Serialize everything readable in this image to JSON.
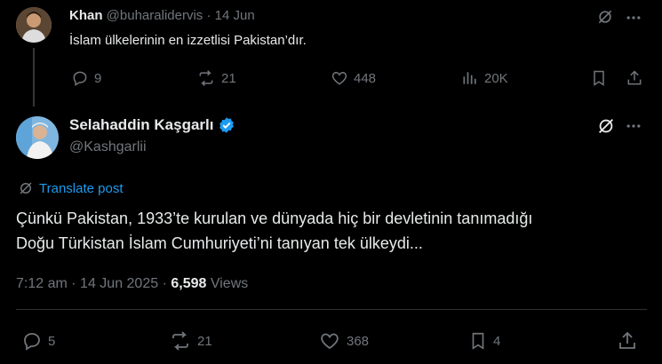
{
  "parent_tweet": {
    "author_name": "Khan",
    "handle": "@buharalidervis",
    "dot": "·",
    "date": "14 Jun",
    "text": "İslam ülkelerinin en izzetlisi Pakistan’dır.",
    "stats": {
      "replies": "9",
      "reposts": "21",
      "likes": "448",
      "views": "20K"
    }
  },
  "main_tweet": {
    "author_name": "Selahaddin Kaşgarlı",
    "handle": "@Kashgarlii",
    "translate_label": "Translate post",
    "text_line1": "Çünkü Pakistan, 1933’te kurulan ve dünyada hiç bir devletinin tanımadığı",
    "text_line2": "Doğu Türkistan İslam Cumhuriyeti’ni tanıyan tek ülkeydi...",
    "time": "7:12 am",
    "sep1": "·",
    "date": "14 Jun 2025",
    "sep2": "·",
    "views_count": "6,598",
    "views_label": "Views",
    "stats": {
      "replies": "5",
      "reposts": "21",
      "likes": "368",
      "bookmarks": "4"
    }
  },
  "colors": {
    "background": "#000000",
    "text": "#e7e9ea",
    "muted": "#71767b",
    "link": "#1d9bf0",
    "verified": "#1d9bf0"
  }
}
